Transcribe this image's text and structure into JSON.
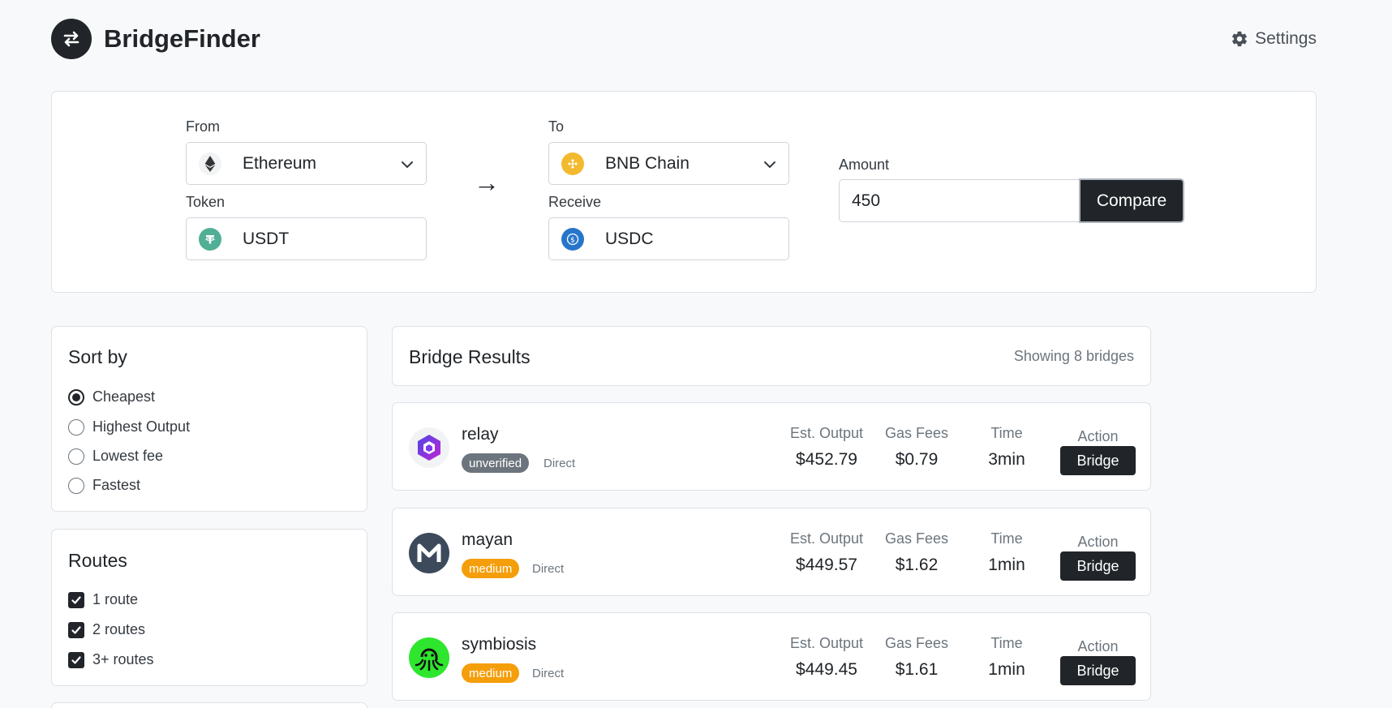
{
  "app": {
    "name": "BridgeFinder",
    "settings_label": "Settings"
  },
  "search": {
    "from_label": "From",
    "from_chain": "Ethereum",
    "token_label": "Token",
    "token": "USDT",
    "to_label": "To",
    "to_chain": "BNB Chain",
    "receive_label": "Receive",
    "receive_token": "USDC",
    "arrow": "→",
    "amount_label": "Amount",
    "amount_value": "450",
    "compare_label": "Compare"
  },
  "sort": {
    "title": "Sort by",
    "options": [
      {
        "label": "Cheapest",
        "selected": true
      },
      {
        "label": "Highest Output",
        "selected": false
      },
      {
        "label": "Lowest fee",
        "selected": false
      },
      {
        "label": "Fastest",
        "selected": false
      }
    ]
  },
  "routes": {
    "title": "Routes",
    "options": [
      {
        "label": "1 route",
        "checked": true
      },
      {
        "label": "2 routes",
        "checked": true
      },
      {
        "label": "3+ routes",
        "checked": true
      }
    ]
  },
  "results": {
    "title": "Bridge Results",
    "count_text": "Showing 8 bridges",
    "col_output": "Est. Output",
    "col_gas": "Gas Fees",
    "col_time": "Time",
    "col_action": "Action",
    "action_button": "Bridge",
    "bridges": [
      {
        "name": "relay",
        "badge": "unverified",
        "route": "Direct",
        "output": "$452.79",
        "gas": "$0.79",
        "time": "3min"
      },
      {
        "name": "mayan",
        "badge": "medium",
        "route": "Direct",
        "output": "$449.57",
        "gas": "$1.62",
        "time": "1min"
      },
      {
        "name": "symbiosis",
        "badge": "medium",
        "route": "Direct",
        "output": "$449.45",
        "gas": "$1.61",
        "time": "1min"
      }
    ]
  },
  "colors": {
    "primary": "#212529",
    "badge_gray": "#6c757d",
    "badge_orange": "#f59e0b",
    "usdt": "#50af95",
    "usdc": "#2775ca",
    "bnb": "#f3ba2f"
  }
}
